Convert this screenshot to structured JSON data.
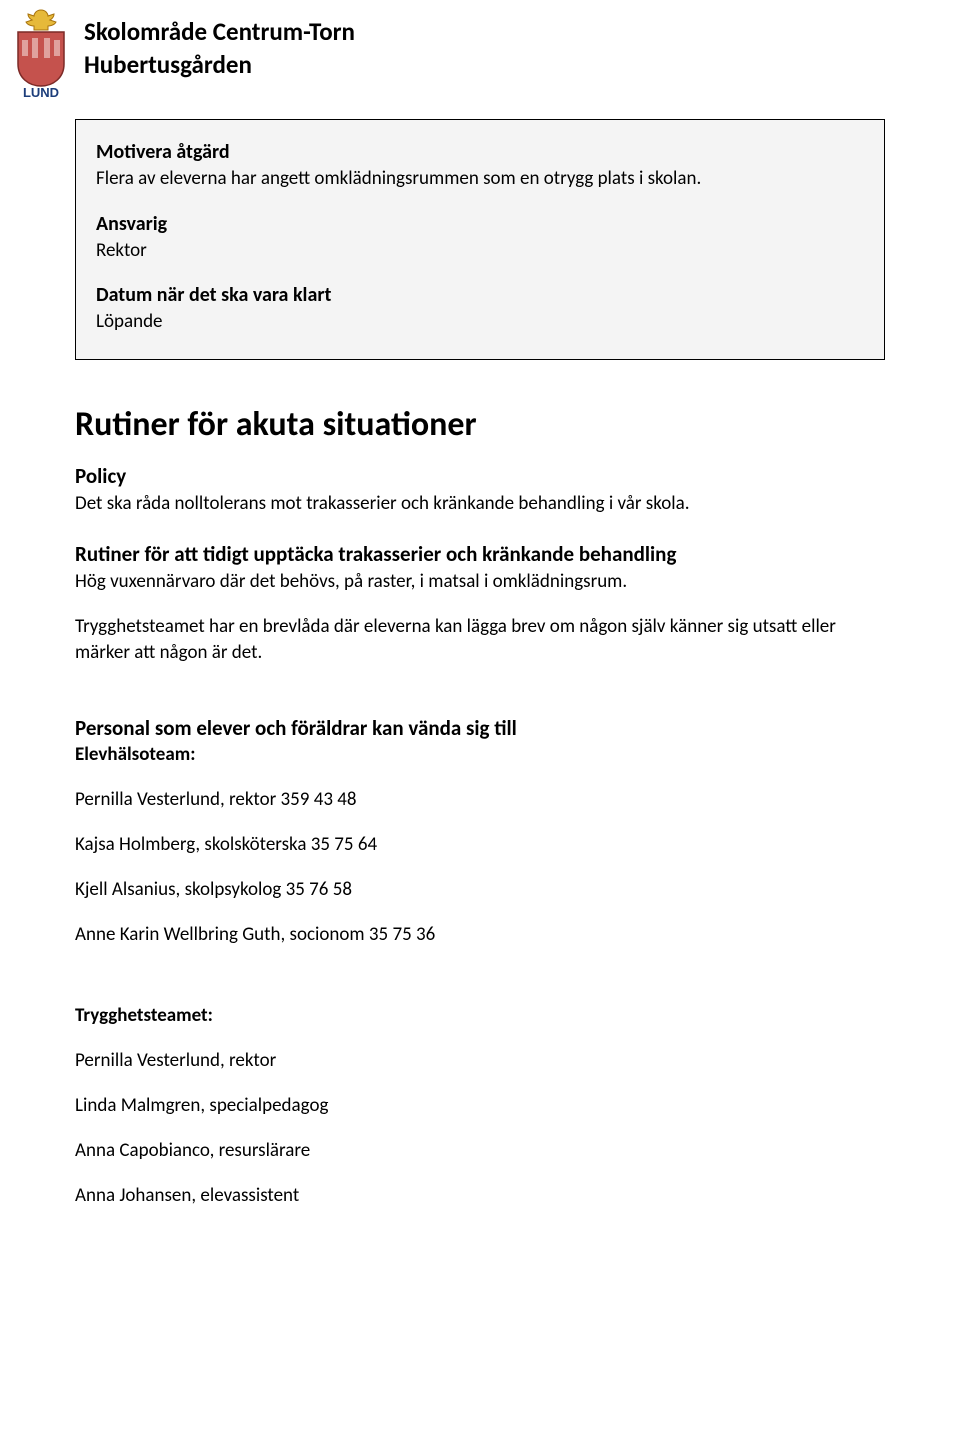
{
  "header": {
    "line1": "Skolområde Centrum-Torn",
    "line2": "Hubertusgården",
    "logo_label": "LUND"
  },
  "info_box": {
    "motivera_heading": "Motivera åtgärd",
    "motivera_text": "Flera av eleverna har angett omklädningsrummen som en otrygg plats i skolan.",
    "ansvarig_heading": "Ansvarig",
    "ansvarig_text": "Rektor",
    "datum_heading": "Datum när det ska vara klart",
    "datum_text": "Löpande"
  },
  "main": {
    "title": "Rutiner för akuta situationer",
    "policy_heading": "Policy",
    "policy_text": "Det ska råda nolltolerans mot trakasserier och kränkande behandling i vår skola.",
    "rutiner_heading": "Rutiner för att tidigt upptäcka trakasserier och kränkande behandling",
    "rutiner_text1": "Hög vuxennärvaro där det behövs, på raster, i matsal i omklädningsrum.",
    "rutiner_text2": "Trygghetsteamet har en brevlåda där eleverna kan lägga brev om någon själv känner sig utsatt eller märker att någon är det.",
    "personal_heading": "Personal som elever och föräldrar kan vända sig till",
    "elevhalso_heading": "Elevhälsoteam:",
    "elevhalso": [
      "Pernilla Vesterlund, rektor 359 43 48",
      "Kajsa Holmberg, skolsköterska 35 75 64",
      "Kjell Alsanius, skolpsykolog 35 76 58",
      "Anne Karin Wellbring Guth, socionom 35 75 36"
    ],
    "trygghet_heading": "Trygghetsteamet:",
    "trygghet": [
      "Pernilla Vesterlund, rektor",
      "Linda Malmgren, specialpedagog",
      "Anna Capobianco, resurslärare",
      "Anna Johansen, elevassistent"
    ]
  }
}
